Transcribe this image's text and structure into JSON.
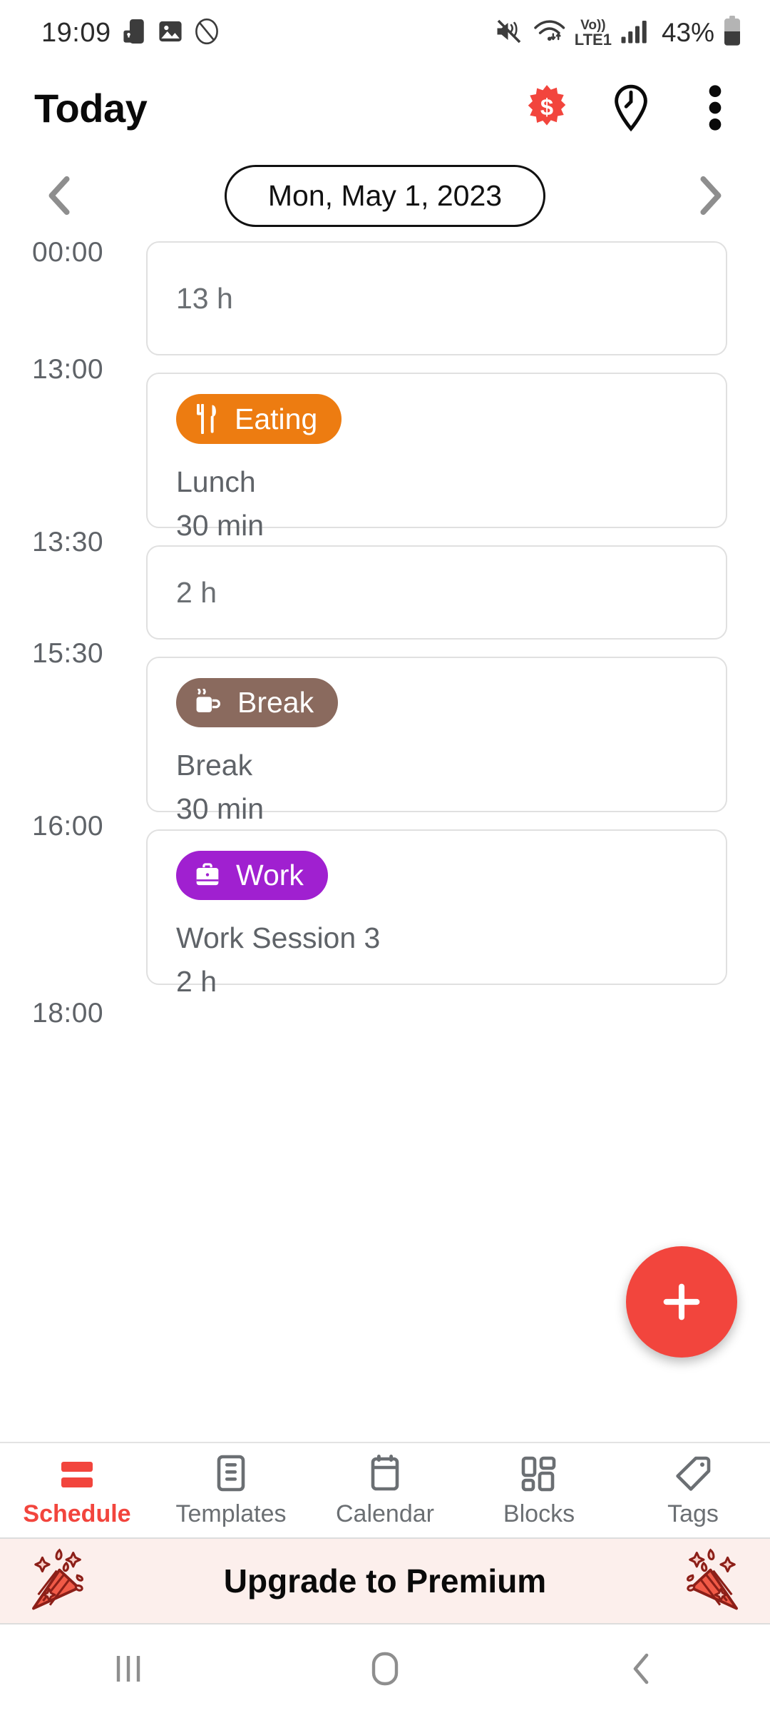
{
  "statusbar": {
    "clock": "19:09",
    "battery_percent": "43%",
    "network_label": "Vo))",
    "network_label2": "LTE1",
    "icons": [
      "phone-lock-icon",
      "image-icon",
      "no-ads-icon",
      "mute-icon",
      "wifi-icon",
      "volte-icon",
      "signal-icon",
      "battery-icon"
    ]
  },
  "appbar": {
    "title": "Today",
    "actions": [
      "premium-dollar-badge",
      "time-location-icon",
      "overflow-menu-icon"
    ]
  },
  "datenav": {
    "prev_label": "‹",
    "next_label": "›",
    "current_date": "Mon, May 1, 2023"
  },
  "timeline": {
    "entries": [
      {
        "kind": "gap",
        "start": "00:00",
        "end": "13:00",
        "duration": "13 h",
        "title": "",
        "tag": "",
        "color": ""
      },
      {
        "kind": "event",
        "start": "13:00",
        "end": "13:30",
        "duration": "30 min",
        "title": "Lunch",
        "tag": "Eating",
        "color": "#ed7c11",
        "icon": "fork-knife-icon"
      },
      {
        "kind": "gap",
        "start": "13:30",
        "end": "15:30",
        "duration": "2 h",
        "title": "",
        "tag": "",
        "color": ""
      },
      {
        "kind": "event",
        "start": "15:30",
        "end": "16:00",
        "duration": "30 min",
        "title": "Break",
        "tag": "Break",
        "color": "#8a6a5e",
        "icon": "coffee-cup-icon"
      },
      {
        "kind": "event",
        "start": "16:00",
        "end": "18:00",
        "duration": "2 h",
        "title": "Work Session 3",
        "tag": "Work",
        "color": "#a020d0",
        "icon": "briefcase-icon"
      }
    ],
    "time_labels": [
      "00:00",
      "13:00",
      "13:30",
      "15:30",
      "16:00",
      "18:00"
    ]
  },
  "fab": {
    "label": "+",
    "color": "#f2453d",
    "name": "add-entry-button"
  },
  "bottomnav": {
    "active_index": 0,
    "accent_color": "#f2453d",
    "items": [
      {
        "label": "Schedule",
        "icon": "schedule-icon"
      },
      {
        "label": "Templates",
        "icon": "templates-icon"
      },
      {
        "label": "Calendar",
        "icon": "calendar-icon"
      },
      {
        "label": "Blocks",
        "icon": "blocks-icon"
      },
      {
        "label": "Tags",
        "icon": "tag-icon"
      }
    ]
  },
  "premium": {
    "text": "Upgrade to Premium",
    "background": "#fcefec",
    "icon": "party-popper-icon"
  },
  "androidnav": {
    "recents_label": "recents-icon",
    "home_label": "home-icon",
    "back_label": "back-icon"
  }
}
